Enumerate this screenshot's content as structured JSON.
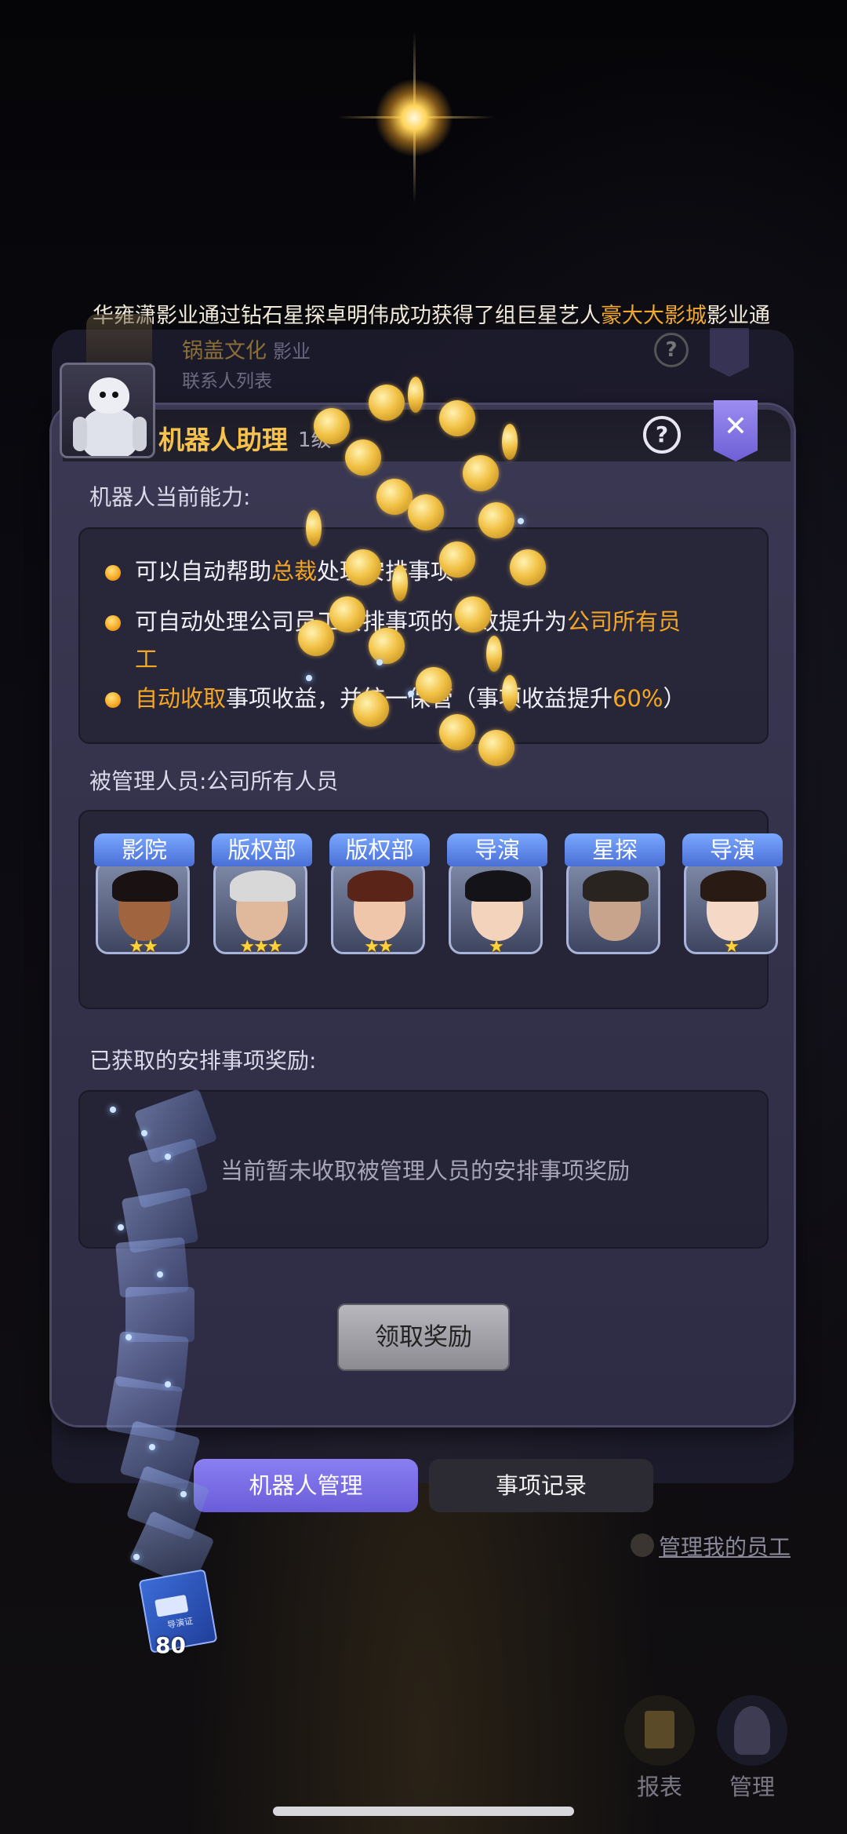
{
  "ticker": {
    "part1": "华雍潇影业通过钻石星探卓明伟成功获得了组巨星艺人",
    "part2": "豪大大影城",
    "part3": "影业通"
  },
  "background_panel": {
    "company": "锅盖文化",
    "company_type": "影业",
    "subtitle": "联系人列表",
    "help": "?",
    "close": "✕",
    "footer_text": "..."
  },
  "dialog": {
    "title": "机器人助理",
    "level": "1级",
    "help": "?",
    "close": "✕"
  },
  "abilities": {
    "label": "机器人当前能力:",
    "items": [
      {
        "pre": "可以自动帮助",
        "hl": "总裁",
        "post": "处理安排事项"
      },
      {
        "pre": "可自动处理公司员工安排事项的人数提升为",
        "hl": "公司所有员工",
        "post": ""
      },
      {
        "pre": "",
        "hl": "自动收取",
        "post": "事项收益，并统一保管（事项收益提升",
        "hl2": "60%",
        "post2": "）"
      }
    ]
  },
  "managed": {
    "label": "被管理人员:公司所有人员",
    "staff": [
      {
        "role": "影院",
        "stars": "★★",
        "skin": "#a0643e",
        "hair": "#1a1212"
      },
      {
        "role": "版权部",
        "stars": "★★★",
        "skin": "#e0b89c",
        "hair": "#d8d8d8"
      },
      {
        "role": "版权部",
        "stars": "★★",
        "skin": "#f0c6aa",
        "hair": "#5a2418"
      },
      {
        "role": "导演",
        "stars": "★",
        "skin": "#f3d3bc",
        "hair": "#141418"
      },
      {
        "role": "星探",
        "stars": "",
        "skin": "#c9a48c",
        "hair": "#2a2420"
      },
      {
        "role": "导演",
        "stars": "★",
        "skin": "#f6d8c6",
        "hair": "#2a1a14"
      }
    ]
  },
  "rewards": {
    "label": "已获取的安排事项奖励:",
    "empty": "当前暂未收取被管理人员的安排事项奖励"
  },
  "claim_button": "领取奖励",
  "tabs": {
    "robot": "机器人管理",
    "records": "事项记录"
  },
  "manage_link": "管理我的员工",
  "bottom_bar": {
    "report": "报表",
    "manage": "管理"
  },
  "book": {
    "label": "导演证",
    "count": "80"
  },
  "colors": {
    "accent_gold": "#f5a623",
    "title_gold": "#f6c24c",
    "tab_purple": "#7a6ee6",
    "panel_bg": "#34324b"
  }
}
